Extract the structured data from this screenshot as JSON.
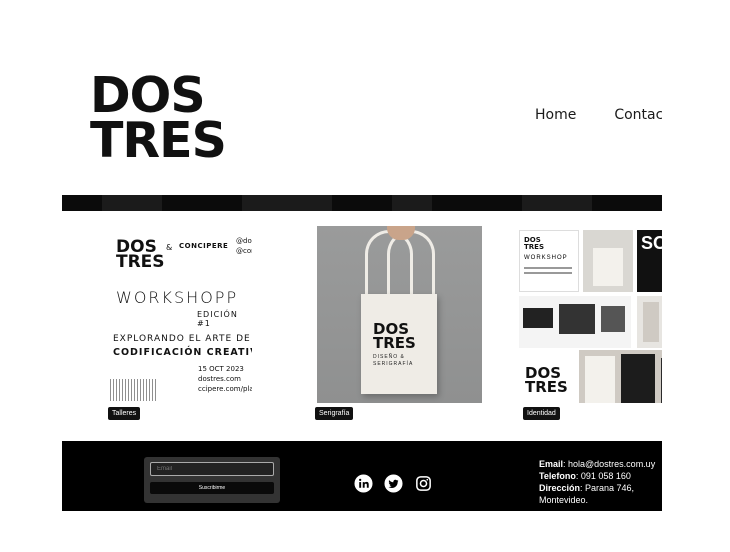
{
  "header": {
    "logo_line1": "DOS",
    "logo_line2": "TRES",
    "nav": [
      "Home",
      "Contacto"
    ]
  },
  "gallery": [
    {
      "tag": "Talleres",
      "flyer": {
        "logo_line1": "DOS",
        "logo_line2": "TRES",
        "amp": "&",
        "partner": "CONCIPERE",
        "handle1": "@dostres.uy",
        "handle2": "@concipere",
        "title": "WORKSHOPP",
        "edition": "EDICIÓN #1",
        "subtitle1": "EXPLORANDO EL ARTE DE LA",
        "subtitle2": "CODIFICACIÓN CREATIVA",
        "date": "15 OCT 2023",
        "site1": "dostres.com",
        "site2": "ccipere.com/playground"
      }
    },
    {
      "tag": "Serigrafía",
      "bag": {
        "logo_line1": "DOS",
        "logo_line2": "TRES",
        "sub1": "DISEÑO &",
        "sub2": "SERIGRAFÍA"
      }
    },
    {
      "tag": "Identidad",
      "collage": {
        "tile_logo_line1": "DOS",
        "tile_logo_line2": "TRES",
        "tile_workshop": "WORKSHOP",
        "big_logo_line1": "DOS",
        "big_logo_line2": "TRES",
        "poster_text": "SO"
      }
    }
  ],
  "footer": {
    "email_placeholder": "Email",
    "subscribe_label": "Suscribirme",
    "social": [
      "linkedin-icon",
      "twitter-icon",
      "instagram-icon"
    ],
    "contact": {
      "email_label": "Email",
      "email_value": ": hola@dostres.com.uy",
      "phone_label": "Telefono",
      "phone_value": ": 091 058 160",
      "address_label": "Dirección",
      "address_value": ": Parana 746,",
      "address_city": "Montevideo."
    }
  },
  "colors": {
    "background": "#ffffff",
    "ink": "#111111",
    "footer": "#000000",
    "tote_bg": "#969797"
  }
}
